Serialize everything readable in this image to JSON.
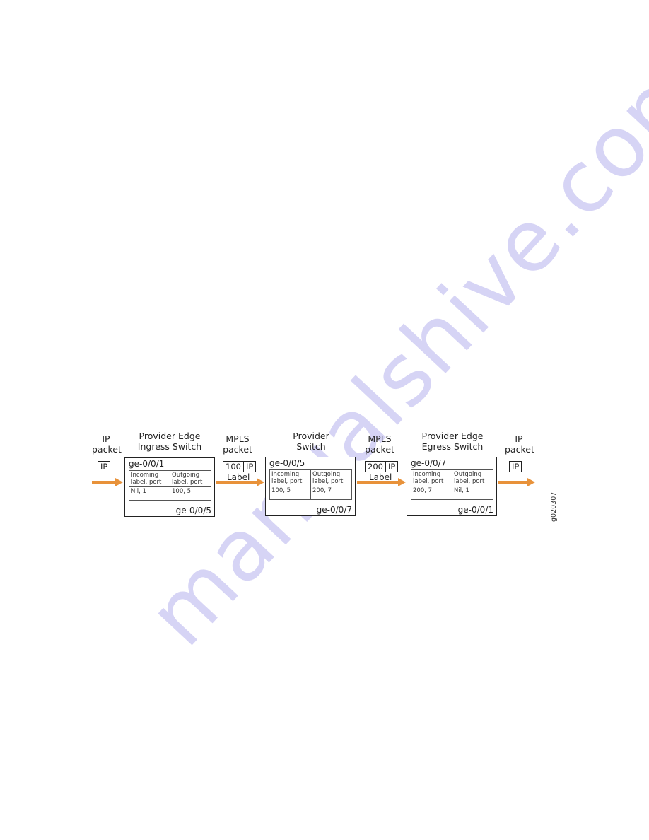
{
  "page": {
    "watermark": "manualshive.com"
  },
  "diagram": {
    "figure_id": "g020307",
    "arrow_color": "#e8923a",
    "watermark_color": "#c9c6f2",
    "nodes": [
      {
        "caption": [
          "IP",
          "packet"
        ],
        "packet": {
          "label": null,
          "payload": "IP"
        }
      },
      {
        "caption": [
          "Provider Edge",
          "Ingress Switch"
        ],
        "in_port": "ge-0/0/1",
        "out_port": "ge-0/0/5",
        "table": {
          "headers": [
            "Incoming label, port",
            "Outgoing label, port"
          ],
          "row": [
            "Nil, 1",
            "100, 5"
          ]
        }
      },
      {
        "caption": [
          "MPLS",
          "packet"
        ],
        "packet": {
          "label": "100",
          "payload": "IP"
        },
        "label_text": "Label"
      },
      {
        "caption": [
          "Provider",
          "Switch"
        ],
        "in_port": "ge-0/0/5",
        "out_port": "ge-0/0/7",
        "table": {
          "headers": [
            "Incoming label, port",
            "Outgoing label, port"
          ],
          "row": [
            "100, 5",
            "200, 7"
          ]
        }
      },
      {
        "caption": [
          "MPLS",
          "packet"
        ],
        "packet": {
          "label": "200",
          "payload": "IP"
        },
        "label_text": "Label"
      },
      {
        "caption": [
          "Provider Edge",
          "Egress Switch"
        ],
        "in_port": "ge-0/0/7",
        "out_port": "ge-0/0/1",
        "table": {
          "headers": [
            "Incoming label, port",
            "Outgoing label, port"
          ],
          "row": [
            "200, 7",
            "Nil, 1"
          ]
        }
      },
      {
        "caption": [
          "IP",
          "packet"
        ],
        "packet": {
          "label": null,
          "payload": "IP"
        }
      }
    ]
  }
}
